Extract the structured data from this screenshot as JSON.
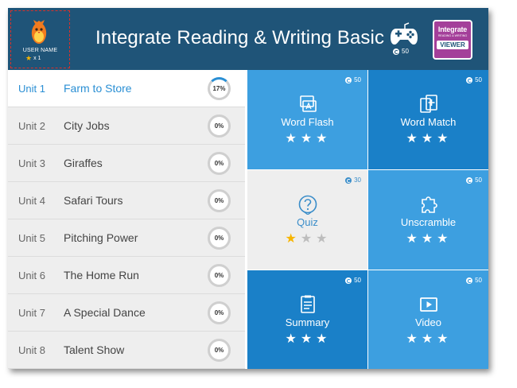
{
  "user": {
    "name": "USER NAME",
    "star_count": "x 1"
  },
  "header": {
    "title": "Integrate Reading & Writing Basic",
    "game_coins": "50",
    "viewer_logo": {
      "line1": "Integrate",
      "line2": "READING & WRITING",
      "line3": "VIEWER"
    }
  },
  "units": [
    {
      "num": "Unit 1",
      "name": "Farm to Store",
      "progress": "17%",
      "progress_value": 0.17,
      "active": true
    },
    {
      "num": "Unit 2",
      "name": "City Jobs",
      "progress": "0%",
      "progress_value": 0,
      "active": false
    },
    {
      "num": "Unit 3",
      "name": "Giraffes",
      "progress": "0%",
      "progress_value": 0,
      "active": false
    },
    {
      "num": "Unit 4",
      "name": "Safari Tours",
      "progress": "0%",
      "progress_value": 0,
      "active": false
    },
    {
      "num": "Unit 5",
      "name": "Pitching Power",
      "progress": "0%",
      "progress_value": 0,
      "active": false
    },
    {
      "num": "Unit 6",
      "name": "The Home Run",
      "progress": "0%",
      "progress_value": 0,
      "active": false
    },
    {
      "num": "Unit 7",
      "name": "A Special Dance",
      "progress": "0%",
      "progress_value": 0,
      "active": false
    },
    {
      "num": "Unit 8",
      "name": "Talent Show",
      "progress": "0%",
      "progress_value": 0,
      "active": false
    }
  ],
  "activities": [
    {
      "label": "Word Flash",
      "cost": "50",
      "icon": "word-flash-icon",
      "stars_earned": 3,
      "stars_total": 3
    },
    {
      "label": "Word Match",
      "cost": "50",
      "icon": "word-match-icon",
      "stars_earned": 3,
      "stars_total": 3
    },
    {
      "label": "Quiz",
      "cost": "30",
      "icon": "quiz-icon",
      "stars_earned": 1,
      "stars_total": 3
    },
    {
      "label": "Unscramble",
      "cost": "50",
      "icon": "puzzle-icon",
      "stars_earned": 3,
      "stars_total": 3
    },
    {
      "label": "Summary",
      "cost": "50",
      "icon": "summary-icon",
      "stars_earned": 3,
      "stars_total": 3
    },
    {
      "label": "Video",
      "cost": "50",
      "icon": "video-icon",
      "stars_earned": 3,
      "stars_total": 3
    }
  ],
  "colors": {
    "header_bg": "#1f5478",
    "accent_blue": "#2a8fd4",
    "tile_blue_light": "#3d9fe0",
    "tile_blue_dark": "#1a80c8",
    "tile_grey": "#eeeeee",
    "star_gold": "#f7b500"
  }
}
